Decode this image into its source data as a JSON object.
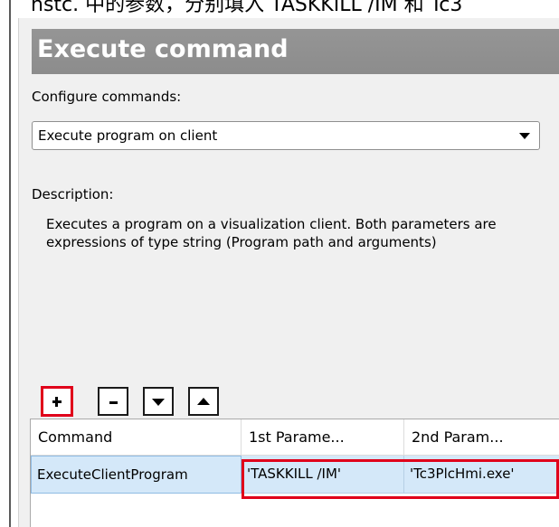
{
  "top_strip_text": "nstc. 中的参数，分别填入 TASKKILL /IM 和 Tc3",
  "panel": {
    "title": "Execute command",
    "configure_label": "Configure commands:",
    "command_select": {
      "value": "Execute program on client"
    },
    "description_label": "Description:",
    "description_text": "Executes a program on a visualization client. Both parameters are expressions of type string (Program path and arguments)"
  },
  "toolbar": {
    "add_button": {
      "icon": "plus-icon",
      "highlighted": true,
      "highlight_color": "#e0001a"
    },
    "remove_button": {
      "icon": "minus-icon"
    },
    "move_down_button": {
      "icon": "arrow-down-icon"
    },
    "move_up_button": {
      "icon": "arrow-up-icon"
    }
  },
  "table": {
    "columns": [
      "Command",
      "1st Parame...",
      "2nd Param..."
    ],
    "rows": [
      [
        "ExecuteClientProgram",
        "'TASKKILL /IM'",
        "'Tc3PlcHmi.exe'"
      ]
    ],
    "selected_row_color": "#d4e8f9",
    "highlighted_cells_color": "#e0001a"
  },
  "colors": {
    "header_bg": "#8f8f8f",
    "panel_bg": "#f0f0f0",
    "highlight": "#e0001a"
  }
}
